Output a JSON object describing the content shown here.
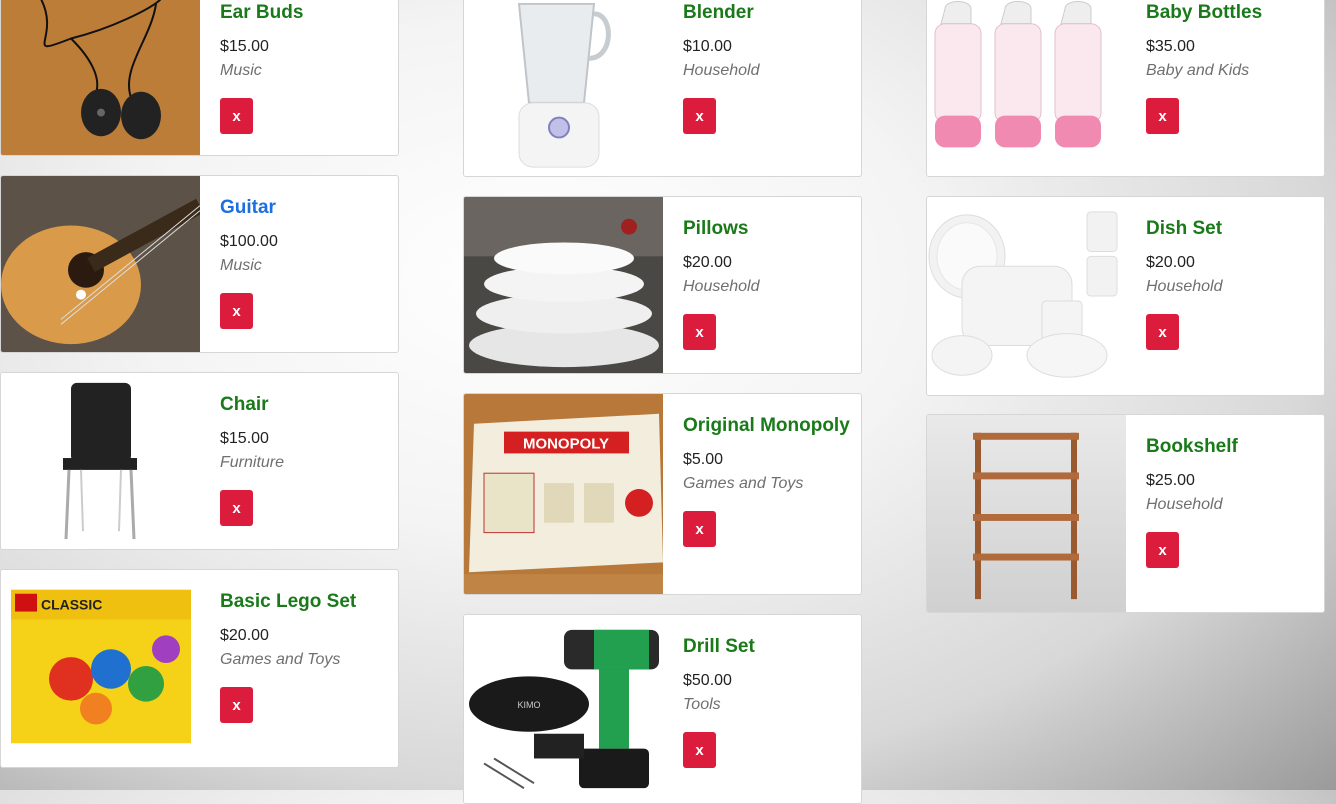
{
  "products": [
    {
      "title": "Ear Buds",
      "price": "$15.00",
      "category": "Music",
      "delete_label": "x",
      "image": "earbuds-photo"
    },
    {
      "title": "Guitar",
      "price": "$100.00",
      "category": "Music",
      "delete_label": "x",
      "image": "guitar-photo"
    },
    {
      "title": "Chair",
      "price": "$15.00",
      "category": "Furniture",
      "delete_label": "x",
      "image": "chair-photo"
    },
    {
      "title": "Basic Lego Set",
      "price": "$20.00",
      "category": "Games and Toys",
      "delete_label": "x",
      "image": "lego-box-photo",
      "image_text": "CLASSIC"
    },
    {
      "title": "Blender",
      "price": "$10.00",
      "category": "Household",
      "delete_label": "x",
      "image": "blender-photo"
    },
    {
      "title": "Pillows",
      "price": "$20.00",
      "category": "Household",
      "delete_label": "x",
      "image": "pillows-photo"
    },
    {
      "title": "Original Monopoly",
      "price": "$5.00",
      "category": "Games and Toys",
      "delete_label": "x",
      "image": "monopoly-board-photo",
      "image_text": "MONOPOLY"
    },
    {
      "title": "Drill Set",
      "price": "$50.00",
      "category": "Tools",
      "delete_label": "x",
      "image": "drill-set-photo",
      "image_text": "KIMO"
    },
    {
      "title": "Baby Bottles",
      "price": "$35.00",
      "category": "Baby and Kids",
      "delete_label": "x",
      "image": "baby-bottles-photo"
    },
    {
      "title": "Dish Set",
      "price": "$20.00",
      "category": "Household",
      "delete_label": "x",
      "image": "dish-set-photo"
    },
    {
      "title": "Bookshelf",
      "price": "$25.00",
      "category": "Household",
      "delete_label": "x",
      "image": "bookshelf-photo"
    }
  ],
  "colors": {
    "title": "#1a7a1a",
    "title_active": "#1d6fe0",
    "delete_button": "#dc1c3c",
    "category": "#6f6f6f"
  }
}
